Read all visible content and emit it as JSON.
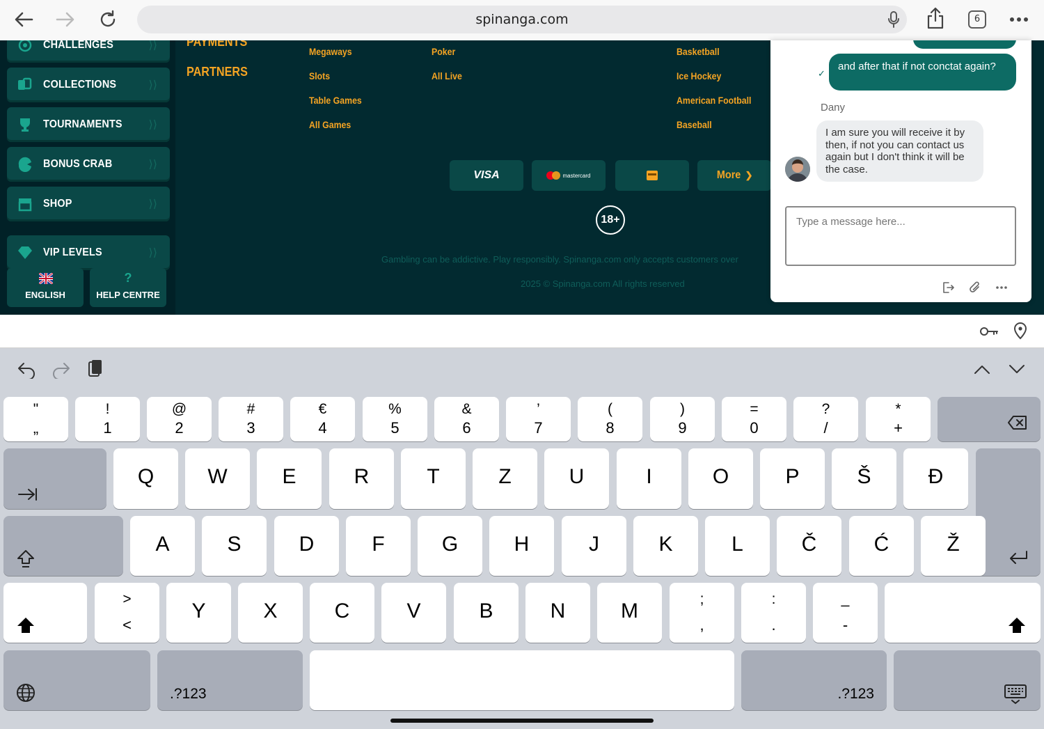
{
  "browser": {
    "url": "spinanga.com",
    "tab_count": "6"
  },
  "sidebar": {
    "items": [
      {
        "label": "CHALLENGES"
      },
      {
        "label": "COLLECTIONS"
      },
      {
        "label": "TOURNAMENTS"
      },
      {
        "label": "BONUS CRAB"
      },
      {
        "label": "SHOP"
      },
      {
        "label": "VIP LEVELS"
      }
    ],
    "language_label": "ENGLISH",
    "help_label": "HELP CENTRE"
  },
  "footer": {
    "payments_head": "PAYMENTS",
    "partners_head": "PARTNERS",
    "casino_links": [
      "Megaways",
      "Slots",
      "Table Games",
      "All Games"
    ],
    "live_links": [
      "Poker",
      "All Live"
    ],
    "sport_links": [
      "Basketball",
      "Ice Hockey",
      "American Football",
      "Baseball"
    ],
    "payment_visa": "VISA",
    "payment_mastercard": "mastercard",
    "payment_more": "More",
    "age_badge": "18+",
    "disclaimer": "Gambling can be addictive. Play responsibly. Spinanga.com only accepts customers over",
    "copyright": "2025 © Spinanga.com All rights reserved"
  },
  "chat": {
    "outgoing_message": "and after that if not conctat again?",
    "agent_name": "Dany",
    "agent_message": "I am sure you will receive it by then, if not you can contact us again but I don't think it will be the case.",
    "input_placeholder": "Type a message here..."
  },
  "keyboard": {
    "number_row": [
      {
        "top": "\"",
        "bot": "„"
      },
      {
        "top": "!",
        "bot": "1"
      },
      {
        "top": "@",
        "bot": "2"
      },
      {
        "top": "#",
        "bot": "3"
      },
      {
        "top": "€",
        "bot": "4"
      },
      {
        "top": "%",
        "bot": "5"
      },
      {
        "top": "&",
        "bot": "6"
      },
      {
        "top": "’",
        "bot": "7"
      },
      {
        "top": "(",
        "bot": "8"
      },
      {
        "top": ")",
        "bot": "9"
      },
      {
        "top": "=",
        "bot": "0"
      },
      {
        "top": "?",
        "bot": "/"
      },
      {
        "top": "*",
        "bot": "+"
      }
    ],
    "row_q": [
      "Q",
      "W",
      "E",
      "R",
      "T",
      "Z",
      "U",
      "I",
      "O",
      "P",
      "Š",
      "Đ"
    ],
    "row_a": [
      "A",
      "S",
      "D",
      "F",
      "G",
      "H",
      "J",
      "K",
      "L",
      "Č",
      "Ć",
      "Ž"
    ],
    "row_y": [
      "Y",
      "X",
      "C",
      "V",
      "B",
      "N",
      "M"
    ],
    "row_y_punct": [
      {
        "top": ">",
        "bot": "<"
      },
      {
        "top": ";",
        "bot": ","
      },
      {
        "top": ":",
        "bot": "."
      },
      {
        "top": "_",
        "bot": "-"
      }
    ],
    "numbers_label": ".?123"
  }
}
